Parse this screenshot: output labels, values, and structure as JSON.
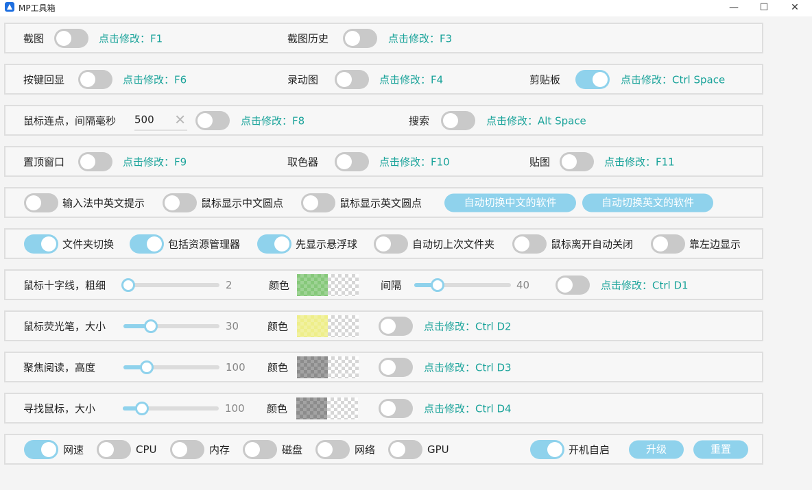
{
  "window": {
    "title": "MP工具箱",
    "minimize_glyph": "—",
    "maximize_glyph": "☐",
    "close_glyph": "✕"
  },
  "colors": {
    "accent": "#8fd2ec",
    "hotkey_text": "#1aa39a",
    "toggle_off": "#c9c9c9"
  },
  "row1": {
    "screenshot": "截图",
    "screenshot_key": "点击修改：F1",
    "history": "截图历史",
    "history_key": "点击修改：F3"
  },
  "row2": {
    "key_echo": "按键回显",
    "key_echo_key": "点击修改：F6",
    "record_gif": "录动图",
    "record_gif_key": "点击修改：F4",
    "clipboard": "剪贴板",
    "clipboard_key": "点击修改：Ctrl Space"
  },
  "row3": {
    "mouse_click": "鼠标连点，间隔毫秒",
    "interval_value": "500",
    "clear_glyph": "✕",
    "mouse_click_key": "点击修改：F8",
    "search": "搜索",
    "search_key": "点击修改：Alt Space"
  },
  "row4": {
    "pin_window": "置顶窗口",
    "pin_window_key": "点击修改：F9",
    "color_picker": "取色器",
    "color_picker_key": "点击修改：F10",
    "pin_image": "贴图",
    "pin_image_key": "点击修改：F11"
  },
  "row5": {
    "ime_hint": "输入法中英文提示",
    "dot_cn": "鼠标显示中文圆点",
    "dot_en": "鼠标显示英文圆点",
    "auto_cn_button": "自动切换中文的软件",
    "auto_en_button": "自动切换英文的软件"
  },
  "row6": {
    "folder_switch": "文件夹切换",
    "include_explorer": "包括资源管理器",
    "show_float_ball": "先显示悬浮球",
    "auto_last_folder": "自动切上次文件夹",
    "auto_close": "鼠标离开自动关闭",
    "dock_left": "靠左边显示"
  },
  "row7": {
    "crosshair": "鼠标十字线，粗细",
    "crosshair_value": "2",
    "color_label": "颜色",
    "swatch_color": "#86c87a",
    "gap_label": "间隔",
    "gap_value": "40",
    "crosshair_key": "点击修改：Ctrl D1"
  },
  "row8": {
    "highlighter": "鼠标荧光笔，大小",
    "highlighter_value": "30",
    "color_label": "颜色",
    "swatch_color": "#eeee8a",
    "highlighter_key": "点击修改：Ctrl D2"
  },
  "row9": {
    "focus_read": "聚焦阅读，高度",
    "focus_value": "100",
    "color_label": "颜色",
    "swatch_color": "#8c8c8c",
    "focus_key": "点击修改：Ctrl D3"
  },
  "row10": {
    "find_mouse": "寻找鼠标，大小",
    "find_value": "100",
    "color_label": "颜色",
    "swatch_color": "#8c8c8c",
    "find_key": "点击修改：Ctrl D4"
  },
  "row11": {
    "net_speed": "网速",
    "cpu": "CPU",
    "memory": "内存",
    "disk": "磁盘",
    "network": "网络",
    "gpu": "GPU",
    "autostart": "开机自启",
    "upgrade_button": "升级",
    "reset_button": "重置"
  },
  "slider_levels": {
    "crosshair": 0.0,
    "gap": 0.2,
    "highlighter": 0.25,
    "focus": 0.2,
    "find": 0.15
  }
}
